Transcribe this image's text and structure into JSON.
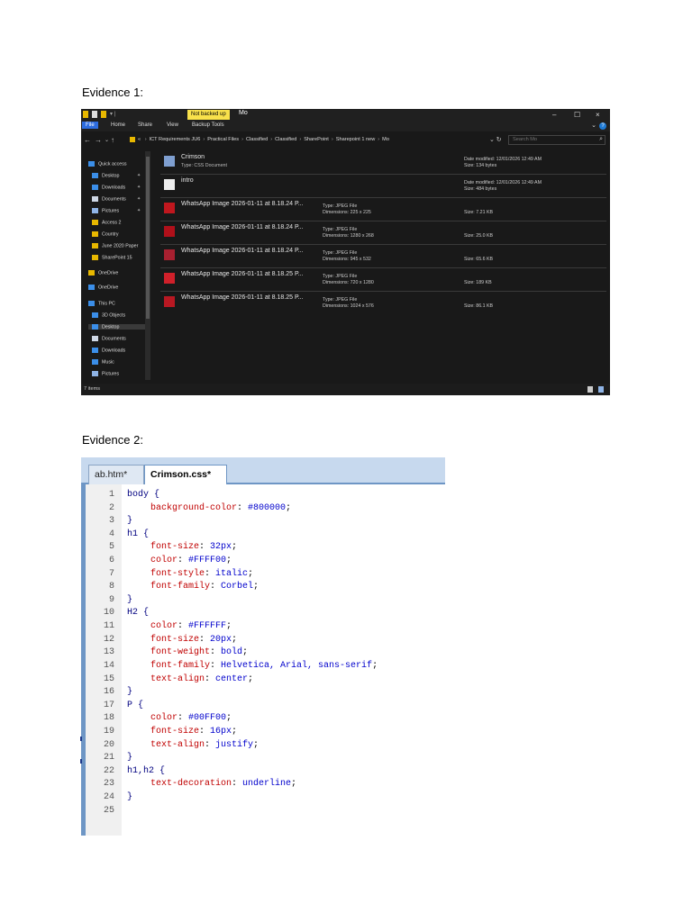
{
  "evidence1": {
    "label": "Evidence 1:",
    "titlebar": {
      "badge": "Not backed up",
      "title": "Mo",
      "minimize": "–",
      "maximize": "☐",
      "close": "×"
    },
    "ribbon": {
      "tabs": [
        "File",
        "Home",
        "Share",
        "View",
        "Backup Tools"
      ],
      "help": "?"
    },
    "address": {
      "prefix": "«",
      "crumbs": [
        "ICT Requirements JU6",
        "Practical Files",
        "Classified",
        "Classified",
        "SharePoint",
        "Sharepoint 1 new",
        "Mo"
      ],
      "search_placeholder": "Search Mo"
    },
    "nav": [
      {
        "label": "Quick access",
        "icon": "star-icon",
        "color": "#3b8ee8"
      },
      {
        "label": "Desktop",
        "icon": "desktop-icon",
        "color": "#3b8ee8",
        "pinned": true
      },
      {
        "label": "Downloads",
        "icon": "download-icon",
        "color": "#3b8ee8",
        "pinned": true
      },
      {
        "label": "Documents",
        "icon": "document-icon",
        "color": "#cfd8e6",
        "pinned": true
      },
      {
        "label": "Pictures",
        "icon": "pictures-icon",
        "color": "#8fb4e6",
        "pinned": true
      },
      {
        "label": "Access 2",
        "icon": "folder-icon",
        "color": "#e8b800"
      },
      {
        "label": "Country",
        "icon": "folder-icon",
        "color": "#e8b800"
      },
      {
        "label": "June 2020 Paper",
        "icon": "folder-icon",
        "color": "#e8b800"
      },
      {
        "label": "SharePoint 15",
        "icon": "folder-icon",
        "color": "#e8b800"
      },
      {
        "label": "OneDrive",
        "icon": "folder-icon",
        "color": "#e8b800"
      },
      {
        "label": "OneDrive",
        "icon": "cloud-icon",
        "color": "#3b8ee8"
      },
      {
        "label": "This PC",
        "icon": "pc-icon",
        "color": "#3b8ee8"
      },
      {
        "label": "3D Objects",
        "icon": "cube-icon",
        "color": "#3b8ee8"
      },
      {
        "label": "Desktop",
        "icon": "desktop-icon",
        "color": "#3b8ee8",
        "selected": true
      },
      {
        "label": "Documents",
        "icon": "document-icon",
        "color": "#cfd8e6"
      },
      {
        "label": "Downloads",
        "icon": "download-icon",
        "color": "#3b8ee8"
      },
      {
        "label": "Music",
        "icon": "music-icon",
        "color": "#3b8ee8"
      },
      {
        "label": "Pictures",
        "icon": "pictures-icon",
        "color": "#8fb4e6"
      }
    ],
    "files": [
      {
        "name": "Crimson",
        "sub": "Type: CSS Document",
        "date": "Date modified: 12/01/2026 12:49 AM",
        "size": "Size: 134 bytes",
        "thumb": "css-file-icon",
        "thumb_color": "#7f9fd0"
      },
      {
        "name": "intro",
        "sub": "",
        "date": "Date modified: 12/01/2026 12:49 AM",
        "size": "Size: 484 bytes",
        "thumb": "text-file-icon",
        "thumb_color": "#eeeeee"
      },
      {
        "name": "WhatsApp Image 2026-01-11 at 8.18.24 P...",
        "type": "Type: JPEG File",
        "dims": "Dimensions: 225 x 225",
        "size": "Size: 7.21 KB",
        "thumb": "image-thumb-icon",
        "thumb_color": "#c0171e"
      },
      {
        "name": "WhatsApp Image 2026-01-11 at 8.18.24 P...",
        "type": "Type: JPEG File",
        "dims": "Dimensions: 1280 x 268",
        "size": "Size: 25.0 KB",
        "thumb": "image-thumb-icon",
        "thumb_color": "#b0101a"
      },
      {
        "name": "WhatsApp Image 2026-01-11 at 8.18.24 P...",
        "type": "Type: JPEG File",
        "dims": "Dimensions: 945 x 532",
        "size": "Size: 65.6 KB",
        "thumb": "image-thumb-icon",
        "thumb_color": "#a82030"
      },
      {
        "name": "WhatsApp Image 2026-01-11 at 8.18.25 P...",
        "type": "Type: JPEG File",
        "dims": "Dimensions: 720 x 1280",
        "size": "Size: 189 KB",
        "thumb": "image-thumb-icon",
        "thumb_color": "#d0202a"
      },
      {
        "name": "WhatsApp Image 2026-01-11 at 8.18.25 P...",
        "type": "Type: JPEG File",
        "dims": "Dimensions: 1024 x 576",
        "size": "Size: 86.1 KB",
        "thumb": "image-thumb-icon",
        "thumb_color": "#b81822"
      }
    ],
    "status": "7 items"
  },
  "evidence2": {
    "label": "Evidence 2:",
    "tabs": [
      "ab.htm*",
      "Crimson.css*"
    ],
    "lines": [
      {
        "n": "1",
        "text": "body {",
        "kind": "sel"
      },
      {
        "n": "2",
        "prop": "background-color",
        "val": "#800000",
        "kind": "decl"
      },
      {
        "n": "3",
        "text": "}",
        "kind": "brace"
      },
      {
        "n": "4",
        "text": "h1 {",
        "kind": "sel"
      },
      {
        "n": "5",
        "prop": "font-size",
        "val": "32px",
        "kind": "decl"
      },
      {
        "n": "6",
        "prop": "color",
        "val": "#FFFF00",
        "kind": "decl"
      },
      {
        "n": "7",
        "prop": "font-style",
        "val": "italic",
        "kind": "decl"
      },
      {
        "n": "8",
        "prop": "font-family",
        "val": "Corbel",
        "kind": "decl"
      },
      {
        "n": "9",
        "text": "}",
        "kind": "brace"
      },
      {
        "n": "10",
        "text": "H2 {",
        "kind": "sel"
      },
      {
        "n": "11",
        "prop": "color",
        "val": "#FFFFFF",
        "kind": "decl"
      },
      {
        "n": "12",
        "prop": "font-size",
        "val": "20px",
        "kind": "decl"
      },
      {
        "n": "13",
        "prop": "font-weight",
        "val": "bold",
        "kind": "decl"
      },
      {
        "n": "14",
        "prop": "font-family",
        "val": "Helvetica, Arial, sans-serif",
        "kind": "decl"
      },
      {
        "n": "15",
        "prop": "text-align",
        "val": "center",
        "kind": "decl"
      },
      {
        "n": "16",
        "text": "}",
        "kind": "brace"
      },
      {
        "n": "17",
        "text": "P {",
        "kind": "sel"
      },
      {
        "n": "18",
        "prop": "color",
        "val": "#00FF00",
        "kind": "decl"
      },
      {
        "n": "19",
        "prop": "font-size",
        "val": "16px",
        "kind": "decl"
      },
      {
        "n": "20",
        "prop": "text-align",
        "val": "justify",
        "kind": "decl"
      },
      {
        "n": "21",
        "text": "}",
        "kind": "brace"
      },
      {
        "n": "22",
        "text": "h1,h2 {",
        "kind": "sel"
      },
      {
        "n": "23",
        "prop": "text-decoration",
        "val": "underline",
        "kind": "decl"
      },
      {
        "n": "24",
        "text": "}",
        "kind": "brace"
      },
      {
        "n": "25",
        "text": "",
        "kind": "empty"
      }
    ]
  }
}
